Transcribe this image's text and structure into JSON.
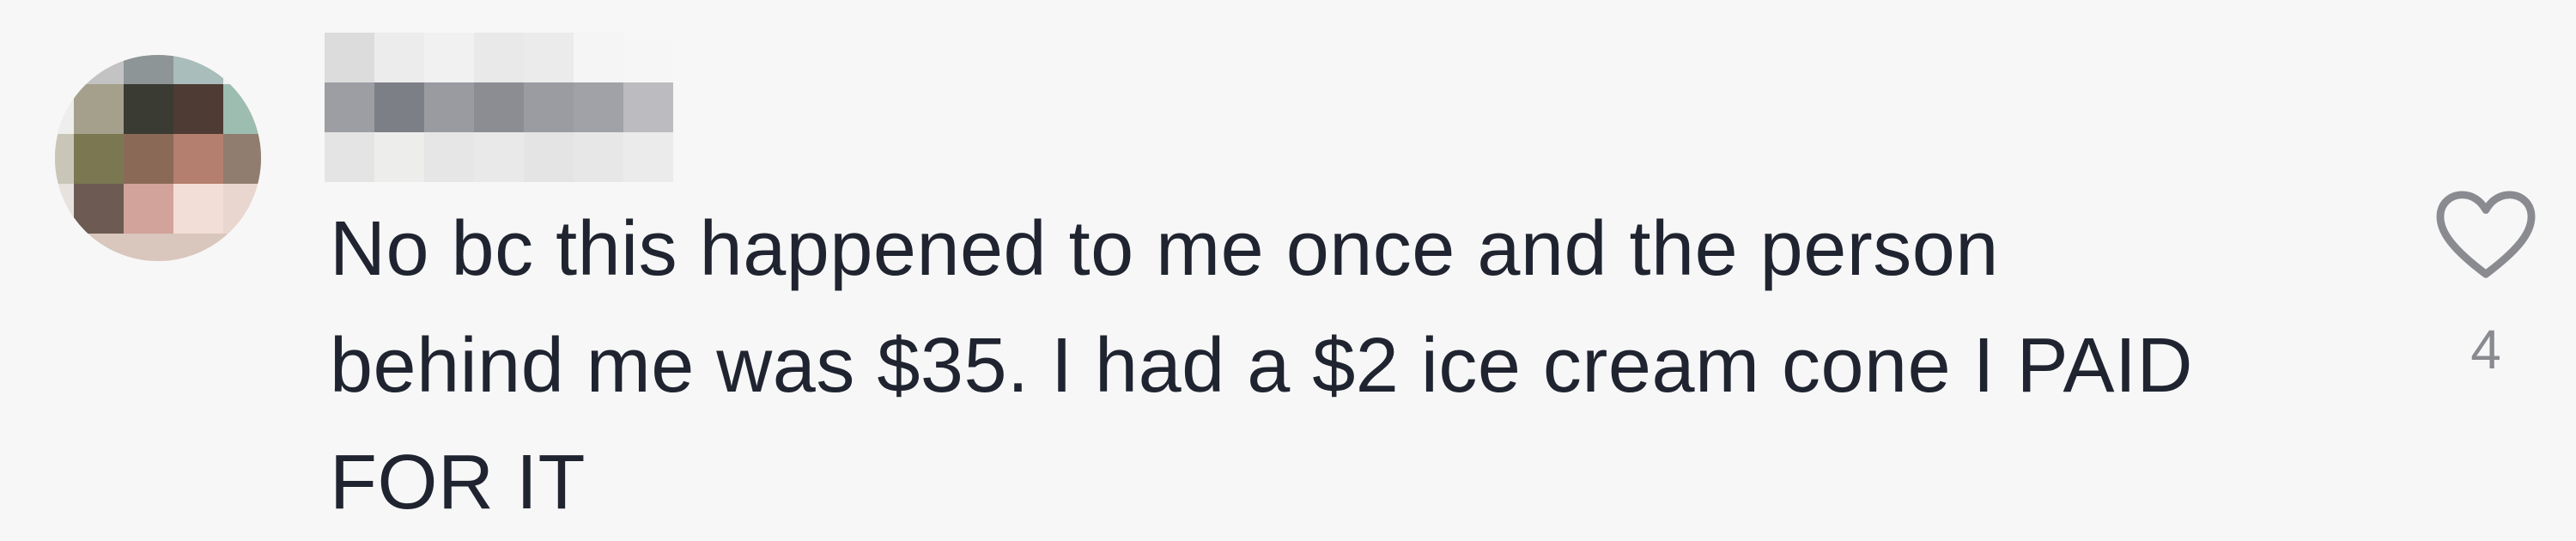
{
  "comment": {
    "text_lines": [
      "No bc this happened to me once and the person",
      "behind me was $35. I had a $2 ice cream cone I PAID",
      "FOR IT"
    ],
    "like_count": "4",
    "icons": {
      "like": "heart-outline-icon"
    },
    "colors": {
      "background": "#f7f7f7",
      "text": "#1f2430",
      "muted": "#8a8b91"
    }
  }
}
